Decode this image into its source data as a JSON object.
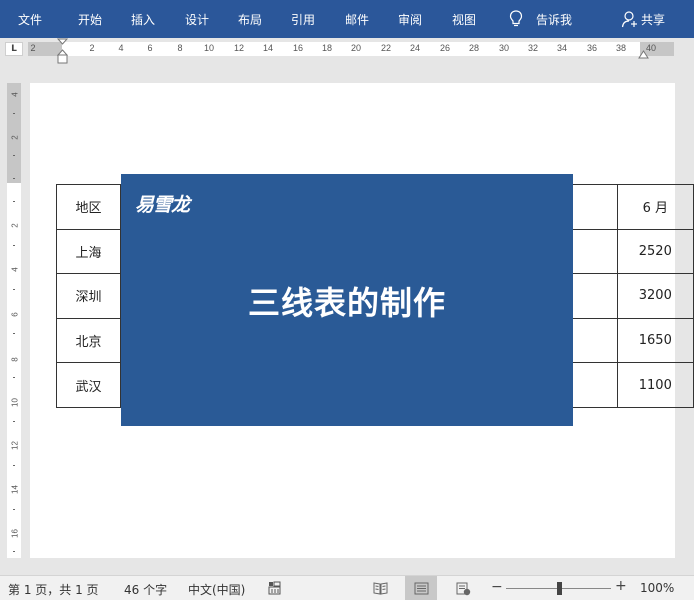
{
  "ribbon": {
    "tabs": [
      {
        "label": "文件"
      },
      {
        "label": "开始"
      },
      {
        "label": "插入"
      },
      {
        "label": "设计"
      },
      {
        "label": "布局"
      },
      {
        "label": "引用"
      },
      {
        "label": "邮件"
      },
      {
        "label": "审阅"
      },
      {
        "label": "视图"
      }
    ],
    "tell_me": "告诉我",
    "share": "共享",
    "color": "#2b579a"
  },
  "ruler": {
    "tab_selector": "L",
    "horizontal_labels": [
      "2",
      "2",
      "4",
      "6",
      "8",
      "10",
      "12",
      "14",
      "16",
      "18",
      "20",
      "22",
      "24",
      "26",
      "28",
      "30",
      "32",
      "34",
      "36",
      "38",
      "40"
    ],
    "vertical_labels": [
      "4",
      "2",
      "2",
      "4",
      "6",
      "8",
      "10",
      "12",
      "14",
      "16"
    ]
  },
  "table": {
    "header": {
      "region": "地区",
      "month": "6 月"
    },
    "rows": [
      {
        "region": "上海",
        "value": "2520"
      },
      {
        "region": "深圳",
        "value": "3200"
      },
      {
        "region": "北京",
        "value": "1650"
      },
      {
        "region": "武汉",
        "value": "1100"
      }
    ]
  },
  "banner": {
    "brand": "易雪龙",
    "title": "三线表的制作",
    "color": "#2a5a96"
  },
  "status": {
    "page": "第 1 页，共 1 页",
    "words": "46 个字",
    "language": "中文(中国)",
    "zoom": "100%",
    "zoom_minus": "−",
    "zoom_plus": "+"
  }
}
